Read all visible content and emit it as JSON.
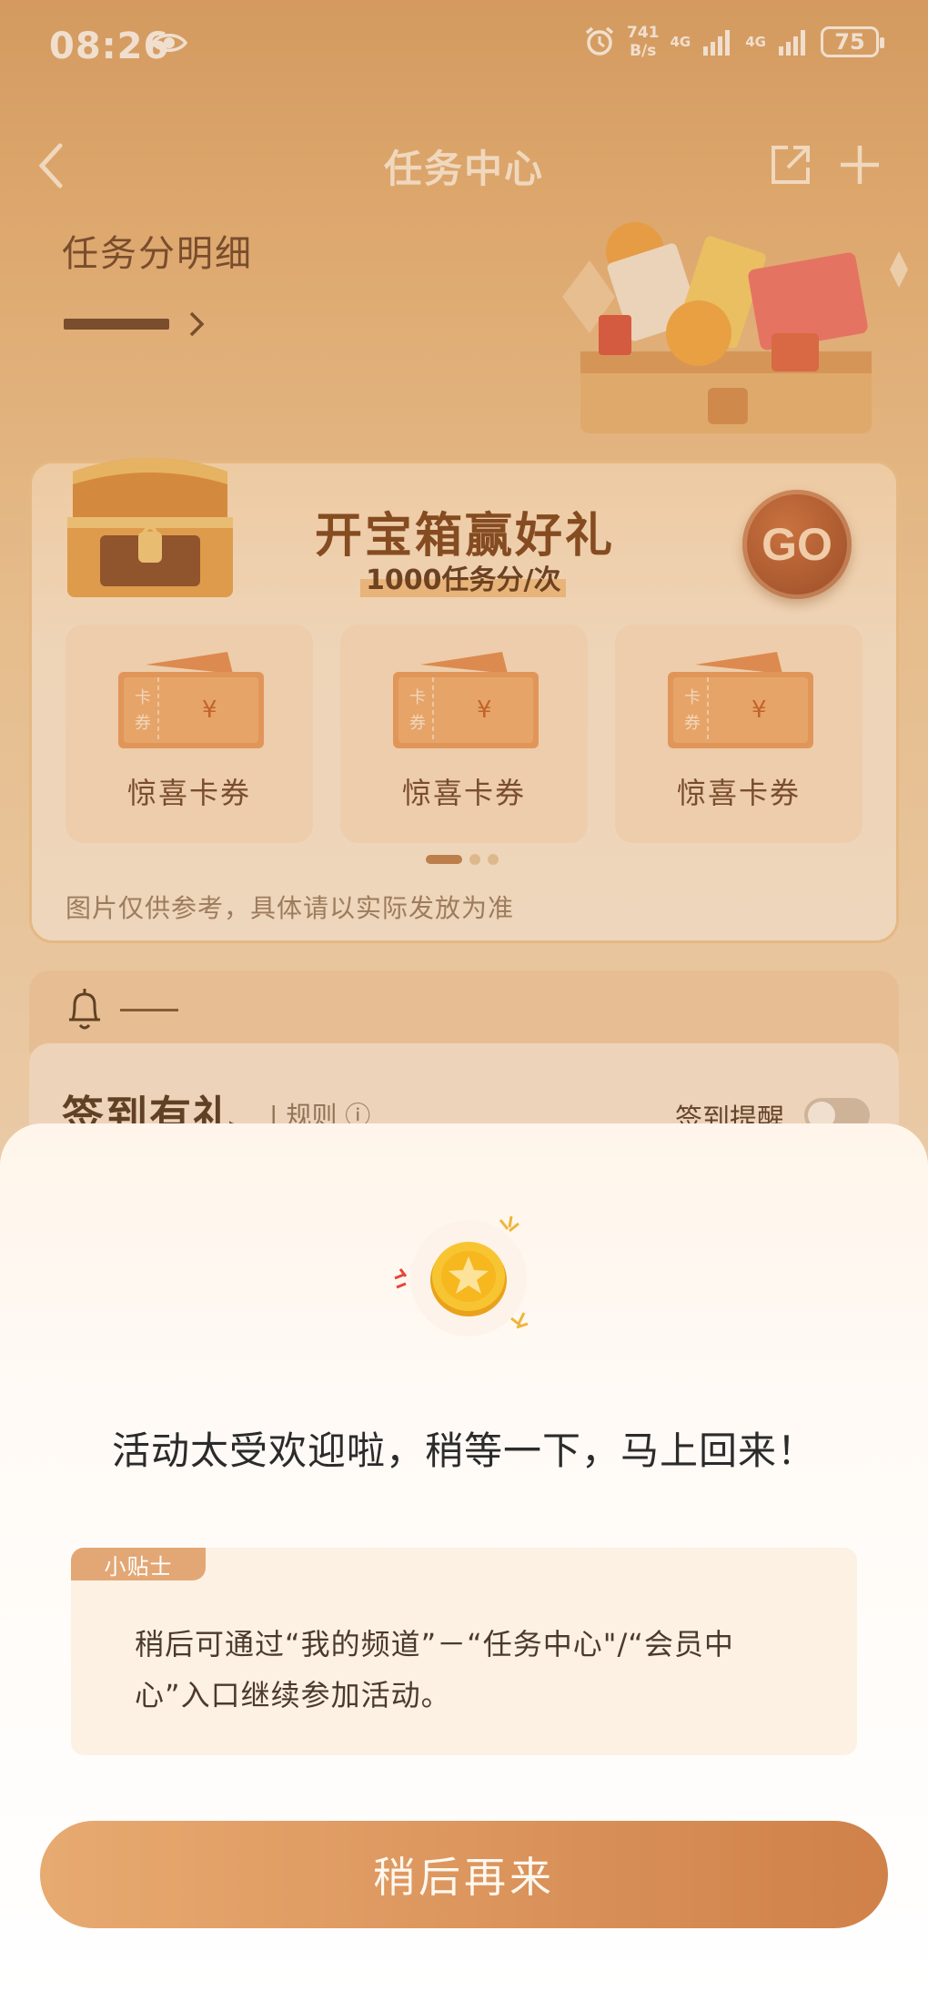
{
  "status_bar": {
    "time": "08:26",
    "net_speed_value": "741",
    "net_speed_unit": "B/s",
    "network_1": "4G",
    "network_2": "4G",
    "battery": "75"
  },
  "nav": {
    "title": "任务中心",
    "icons": [
      "back-icon",
      "share-icon",
      "add-icon"
    ]
  },
  "points": {
    "label": "任务分明细"
  },
  "chest_card": {
    "title": "开宝箱赢好礼",
    "subtitle": "1000任务分/次",
    "go_label": "GO",
    "coupons": [
      {
        "label": "惊喜卡券"
      },
      {
        "label": "惊喜卡券"
      },
      {
        "label": "惊喜卡券"
      }
    ],
    "disclaimer": "图片仅供参考，具体请以实际发放为准"
  },
  "signin": {
    "title": "签到有礼",
    "rule_label": "规则",
    "remind_label": "签到提醒"
  },
  "sheet": {
    "message": "活动太受欢迎啦，稍等一下，马上回来！",
    "tip_badge": "小贴士",
    "tip_text": "稍后可通过“我的频道”－“任务中心\"/“会员中心”入口继续参加活动。",
    "button_label": "稍后再来"
  },
  "colors": {
    "accent": "#dc965e",
    "title_brown": "#6b3210",
    "go_button": "#9c4322"
  }
}
